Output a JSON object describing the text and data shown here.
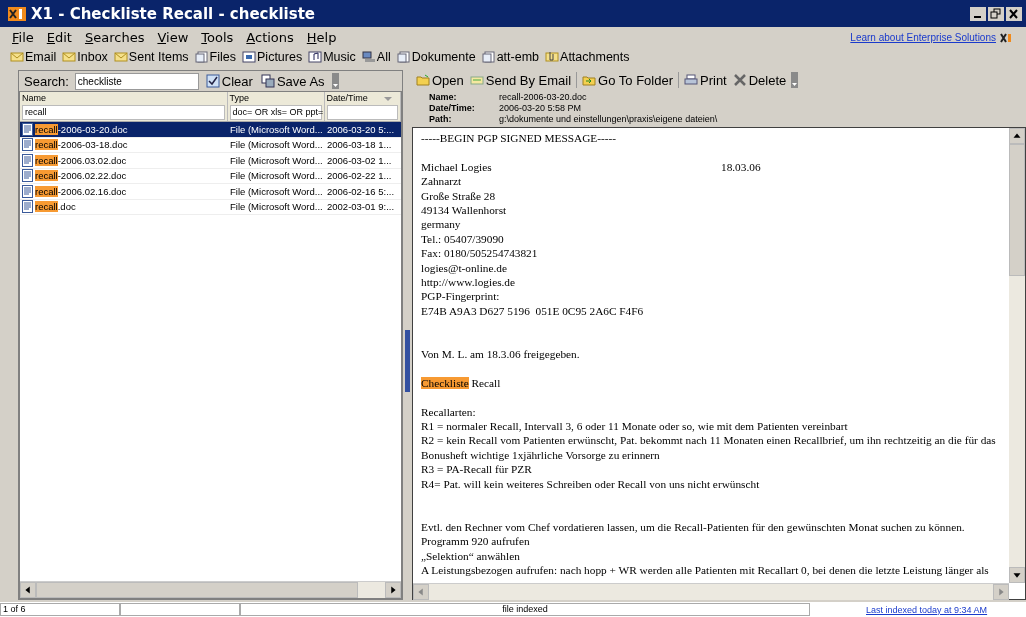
{
  "window": {
    "title": "X1 - Checkliste Recall - checkliste"
  },
  "menu": [
    "File",
    "Edit",
    "Searches",
    "View",
    "Tools",
    "Actions",
    "Help"
  ],
  "enterprise_link": "Learn about Enterprise Solutions",
  "favorites": [
    {
      "label": "Email",
      "kind": "email"
    },
    {
      "label": "Inbox",
      "kind": "email"
    },
    {
      "label": "Sent Items",
      "kind": "email"
    },
    {
      "label": "Files",
      "kind": "file"
    },
    {
      "label": "Pictures",
      "kind": "picture"
    },
    {
      "label": "Music",
      "kind": "music"
    },
    {
      "label": "All",
      "kind": "all"
    },
    {
      "label": "Dokumente",
      "kind": "file"
    },
    {
      "label": "att-emb",
      "kind": "file"
    },
    {
      "label": "Attachments",
      "kind": "attachment"
    }
  ],
  "search": {
    "label": "Search:",
    "value": "checkliste",
    "buttons": [
      {
        "label": "Clear",
        "kind": "clear"
      },
      {
        "label": "Save As",
        "kind": "save"
      }
    ]
  },
  "table": {
    "columns": [
      {
        "label": "Name",
        "filter": "recall"
      },
      {
        "label": "Type",
        "filter": "doc= OR xls= OR ppt="
      },
      {
        "label": "Date/Time"
      }
    ],
    "rows": [
      {
        "match": "recall",
        "name": "-2006-03-20.doc",
        "type": "File (Microsoft Word...",
        "date": "2006-03-20 5:...",
        "selected": true
      },
      {
        "match": "recall",
        "name": "-2006-03-18.doc",
        "type": "File (Microsoft Word...",
        "date": "2006-03-18 1...",
        "selected": false
      },
      {
        "match": "recall",
        "name": "-2006.03.02.doc",
        "type": "File (Microsoft Word...",
        "date": "2006-03-02 1...",
        "selected": false
      },
      {
        "match": "recall",
        "name": "-2006.02.22.doc",
        "type": "File (Microsoft Word...",
        "date": "2006-02-22 1...",
        "selected": false
      },
      {
        "match": "recall",
        "name": "-2006.02.16.doc",
        "type": "File (Microsoft Word...",
        "date": "2006-02-16 5:...",
        "selected": false
      },
      {
        "match": "recall",
        "name": ".doc",
        "type": "File (Microsoft Word...",
        "date": "2002-03-01 9:...",
        "selected": false
      }
    ]
  },
  "preview": {
    "toolbar": [
      {
        "label": "Open",
        "kind": "open"
      },
      {
        "label": "Send By Email",
        "kind": "email"
      },
      {
        "label": "Go To Folder",
        "kind": "folder"
      },
      {
        "label": "Print",
        "kind": "print"
      },
      {
        "label": "Delete",
        "kind": "delete"
      }
    ],
    "details": [
      {
        "label": "Name:",
        "value": "recall-2006-03-20.doc"
      },
      {
        "label": "Date/Time:",
        "value": "2006-03-20 5:58 PM"
      },
      {
        "label": "Path:",
        "value": "g:\\dokumente und einstellungen\\praxis\\eigene dateien\\"
      }
    ],
    "blocks": [
      {
        "kind": "paragraph",
        "lines": [
          {
            "text": "-----BEGIN PGP SIGNED MESSAGE-----"
          }
        ]
      },
      {
        "kind": "section",
        "lines": [
          {
            "text": "Michael Logies",
            "aside": "18.03.06"
          },
          {
            "text": "Zahnarzt"
          },
          {
            "text": "Große Straße 28"
          },
          {
            "text": "49134 Wallenhorst"
          },
          {
            "text": "germany"
          },
          {
            "text": "Tel.: 05407/39090"
          },
          {
            "text": "Fax: 0180/505254743821"
          },
          {
            "text": "logies@t-online.de"
          },
          {
            "text": "http://www.logies.de"
          },
          {
            "text": "PGP-Fingerprint:"
          },
          {
            "text": "E74B A9A3 D627 5196  051E 0C95 2A6C F4F6"
          }
        ]
      },
      {
        "kind": "paragraph",
        "lines": [
          {
            "text": "Von M. L. am 18.3.06 freigegeben."
          }
        ]
      },
      {
        "kind": "paragraph",
        "lines": [
          {
            "match": "Checkliste",
            "text": " Recall"
          }
        ]
      },
      {
        "kind": "section",
        "lines": [
          {
            "text": "Recallarten:"
          },
          {
            "text": "R1 = normaler Recall, Intervall 3, 6 oder 11 Monate oder so, wie mit dem Patienten vereinbart"
          },
          {
            "text": "R2 = kein Recall vom Patienten erwünscht, Pat. bekommt nach 11 Monaten einen Recallbrief, um ihn rechtzeitig an die für das Bonusheft wichtige 1xjährliche Vorsorge zu erinnern"
          },
          {
            "text": "R3 = PA-Recall für PZR"
          },
          {
            "text": "R4= Pat. will kein weiteres Schreiben oder Recall von uns nicht erwünscht"
          }
        ]
      },
      {
        "kind": "paragraph",
        "lines": [
          {
            "text": "Evtl. den Rechner vom Chef vordatieren lassen, um die Recall-Patienten für den gewünschten Monat suchen zu können."
          },
          {
            "text": "Programm 920 aufrufen"
          },
          {
            "text": "„Selektion“ anwählen"
          },
          {
            "text": "A Leistungsbezogen aufrufen: nach hopp + WR werden alle Patienten mit Recallart 0, bei denen die letzte Leistung länger als"
          }
        ]
      }
    ]
  },
  "status_bar": {
    "count": "1 of 6",
    "message": "file indexed",
    "link": "Last indexed today at 9:34 AM"
  }
}
